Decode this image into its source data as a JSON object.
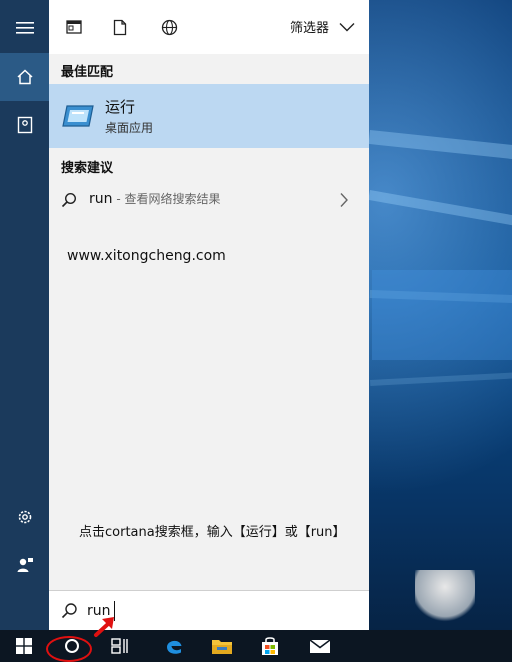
{
  "start_menu": {
    "filter_label": "筛选器",
    "best_match_header": "最佳匹配",
    "best_match": {
      "title": "运行",
      "subtitle": "桌面应用"
    },
    "suggestions_header": "搜索建议",
    "suggestion": {
      "query": "run",
      "hint": " - 查看网络搜索结果"
    },
    "watermark": "www.xitongcheng.com",
    "annotation": "点击cortana搜索框，输入【运行】或【run】",
    "search": {
      "value": "run",
      "placeholder": ""
    }
  },
  "icons": {
    "rail": [
      "hamburger-icon",
      "home-icon",
      "notebook-icon",
      "gear-icon",
      "user-icon"
    ],
    "topbar": [
      "app-view-icon",
      "document-icon",
      "globe-icon",
      "chevron-down-icon"
    ],
    "taskbar": [
      "windows-start-icon",
      "cortana-icon",
      "task-view-icon",
      "edge-icon",
      "file-explorer-icon",
      "store-icon",
      "mail-icon"
    ]
  },
  "colors": {
    "rail": "#1b3a5c",
    "highlight": "#bcd8f2",
    "taskbar": "#0c1622",
    "annotation_red": "#e01010"
  }
}
